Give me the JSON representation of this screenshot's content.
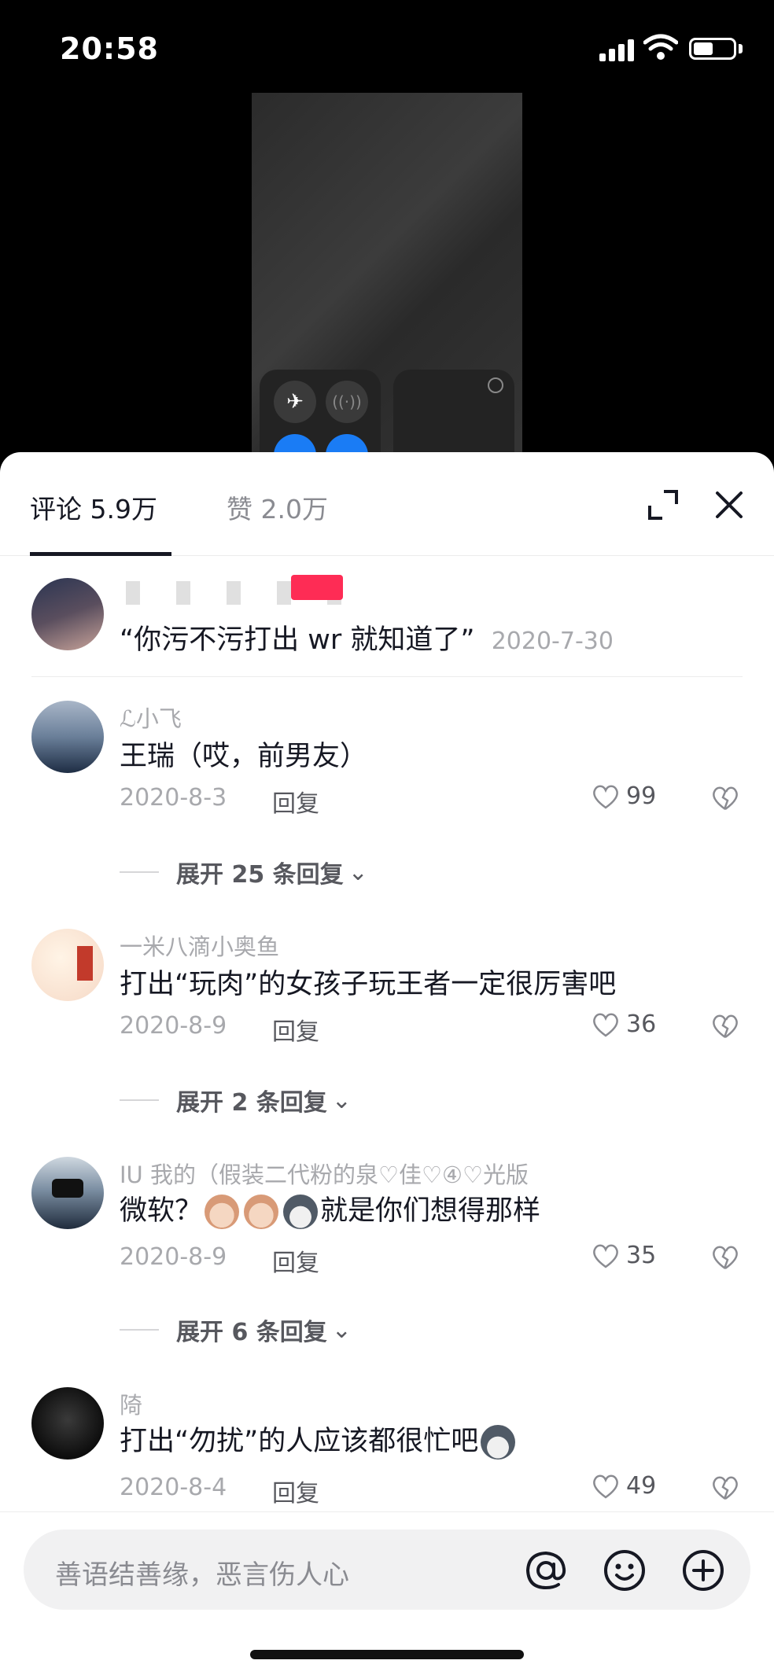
{
  "status": {
    "time": "20:58"
  },
  "sheet": {
    "tabs": {
      "comments": "评论 5.9万",
      "likes": "赞 2.0万"
    }
  },
  "pinned": {
    "text": "“你污不污打出 wr 就知道了”",
    "date": "2020-7-30"
  },
  "comments": [
    {
      "name": "ℒ小飞",
      "text": "王瑞（哎，前男友）",
      "date": "2020-8-3",
      "reply": "回复",
      "likes": "99",
      "expand": "展开 25 条回复"
    },
    {
      "name": "一米八滴小奥鱼",
      "text": "打出“玩肉”的女孩子玩王者一定很厉害吧",
      "date": "2020-8-9",
      "reply": "回复",
      "likes": "36",
      "expand": "展开 2 条回复"
    },
    {
      "name": "IU 我的（假装二代粉的泉♡佳♡④♡光版",
      "text_before": "微软？",
      "text_after": "就是你们想得那样",
      "date": "2020-8-9",
      "reply": "回复",
      "likes": "35",
      "expand": "展开 6 条回复"
    },
    {
      "name": "陭",
      "text": "打出“勿扰”的人应该都很忙吧",
      "date": "2020-8-4",
      "reply": "回复",
      "likes": "49"
    }
  ],
  "input": {
    "placeholder": "善语结善缘，恶言伤人心"
  }
}
